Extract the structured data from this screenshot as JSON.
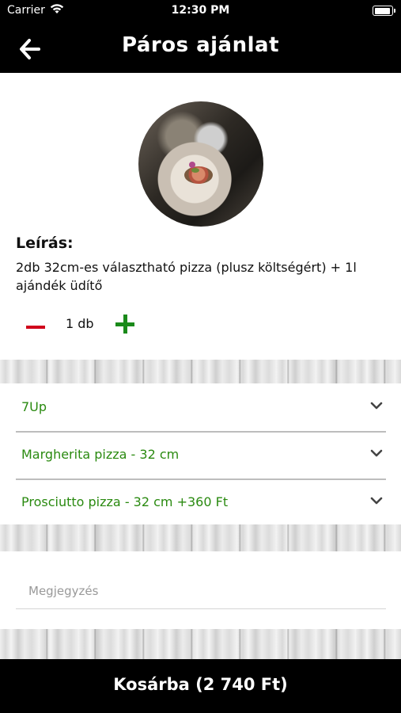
{
  "status_bar": {
    "carrier": "Carrier",
    "time": "12:30 PM",
    "wifi_icon": "wifi-icon",
    "battery_icon": "battery-icon"
  },
  "header": {
    "title": "Páros ajánlat",
    "back_icon": "arrow-left-icon"
  },
  "product": {
    "image_alt": "food-photo",
    "description_label": "Leírás:",
    "description": "2db 32cm-es választható pizza (plusz költségért) + 1l ajándék üdítő"
  },
  "quantity": {
    "value": "1 db",
    "minus_icon": "minus-icon",
    "plus_icon": "plus-icon"
  },
  "options": [
    {
      "label": "7Up"
    },
    {
      "label": "Margherita pizza - 32 cm"
    },
    {
      "label": "Prosciutto pizza - 32 cm +360 Ft"
    }
  ],
  "notes": {
    "placeholder": "Megjegyzés",
    "value": ""
  },
  "cart": {
    "label": "Kosárba (2 740 Ft)"
  },
  "colors": {
    "accent_green": "#2a8a10",
    "minus_red": "#d0021b",
    "bar": "#000000"
  }
}
